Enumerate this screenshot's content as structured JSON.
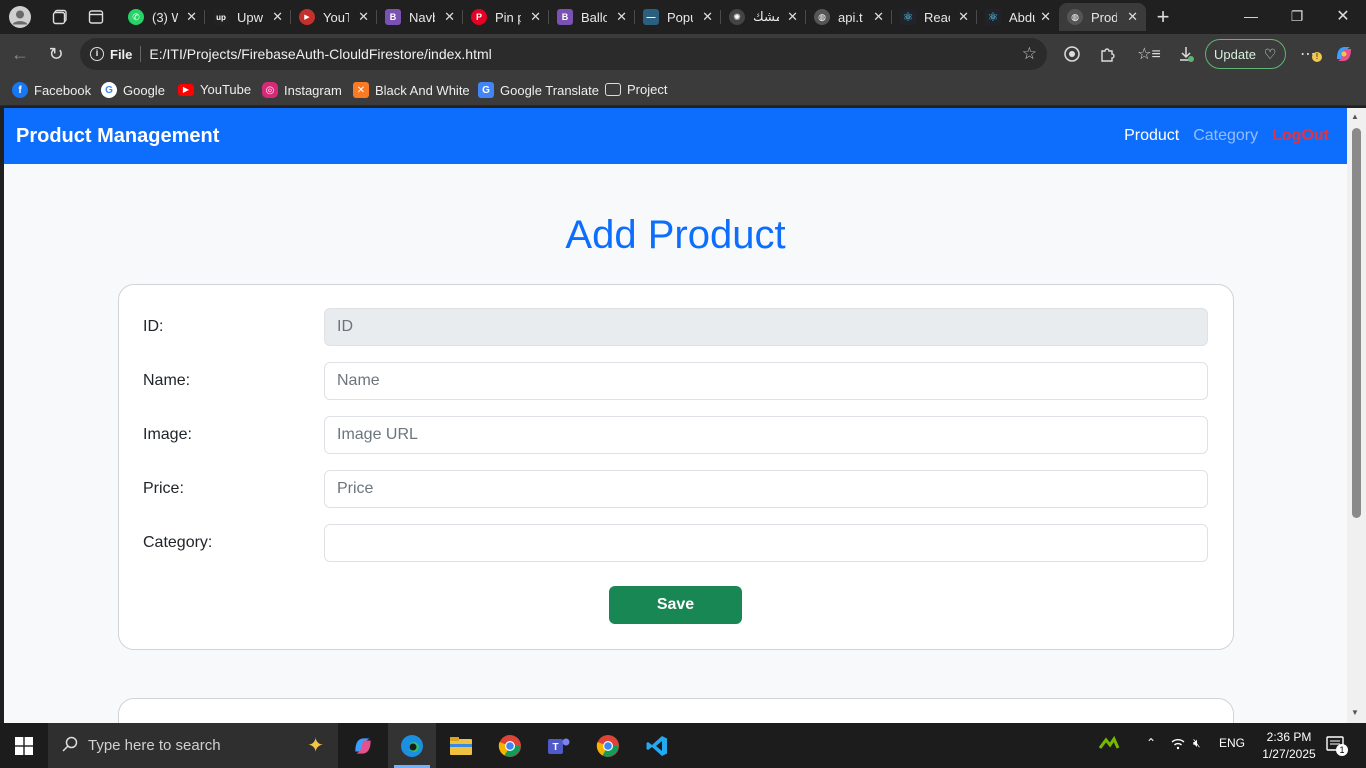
{
  "browser": {
    "tabs": [
      {
        "title": "(3) W",
        "icon": "whatsapp-icon",
        "color": "#25d366",
        "glyph": "✆"
      },
      {
        "title": "Upw",
        "icon": "upwork-icon",
        "color": "#222222",
        "glyph": "up"
      },
      {
        "title": "YouT",
        "icon": "youtube-icon",
        "color": "#c4302b",
        "glyph": "▶"
      },
      {
        "title": "Navb",
        "icon": "bootstrap-icon",
        "color": "#7952b3",
        "glyph": "B"
      },
      {
        "title": "Pin p",
        "icon": "pinterest-icon",
        "color": "#e60023",
        "glyph": "P"
      },
      {
        "title": "Ballo",
        "icon": "bootstrap-icon",
        "color": "#7952b3",
        "glyph": "B"
      },
      {
        "title": "Popu",
        "icon": "site-icon",
        "color": "#2a5f7f",
        "glyph": "—"
      },
      {
        "title": "مشك",
        "icon": "openai-icon",
        "color": "#444444",
        "glyph": "✺"
      },
      {
        "title": "api.t",
        "icon": "globe-icon",
        "color": "#555555",
        "glyph": "◍"
      },
      {
        "title": "Reac",
        "icon": "react-icon",
        "color": "#20232a",
        "glyph": "⚛"
      },
      {
        "title": "Abdu",
        "icon": "react-icon",
        "color": "#20232a",
        "glyph": "⚛"
      },
      {
        "title": "Prod",
        "icon": "globe-icon",
        "color": "#555555",
        "glyph": "◍"
      }
    ],
    "new_tab": "+",
    "address": {
      "scheme_label": "File",
      "url": "E:/ITI/Projects/FirebaseAuth-ClouldFirestore/index.html"
    },
    "update_label": "Update",
    "bookmarks": [
      {
        "label": "Facebook",
        "icon": "facebook-icon",
        "color": "#1877f2",
        "glyph": "f"
      },
      {
        "label": "Google",
        "icon": "google-icon",
        "color": "#ffffff",
        "glyph": "G"
      },
      {
        "label": "YouTube",
        "icon": "youtube-icon",
        "color": "#ff0000",
        "glyph": "▶"
      },
      {
        "label": "Instagram",
        "icon": "instagram-icon",
        "color": "#d62976",
        "glyph": "◎"
      },
      {
        "label": "Black And White",
        "icon": "xampp-icon",
        "color": "#fb7a24",
        "glyph": "✕"
      },
      {
        "label": "Google Translate",
        "icon": "translate-icon",
        "color": "#4285f4",
        "glyph": "G"
      },
      {
        "label": "Project",
        "icon": "folder-icon",
        "color": "#3b3b3b",
        "glyph": "▭"
      }
    ]
  },
  "app": {
    "brand": "Product Management",
    "nav": {
      "product": "Product",
      "category": "Category",
      "logout": "LogOut"
    },
    "heading": "Add Product",
    "form": {
      "id_label": "ID:",
      "id_placeholder": "ID",
      "name_label": "Name:",
      "name_placeholder": "Name",
      "image_label": "Image:",
      "image_placeholder": "Image URL",
      "price_label": "Price:",
      "price_placeholder": "Price",
      "category_label": "Category:",
      "category_value": "",
      "save_label": "Save"
    },
    "colors": {
      "primary": "#0d6efd",
      "success": "#198754",
      "danger": "#dc3545"
    }
  },
  "taskbar": {
    "search_placeholder": "Type here to search",
    "language": "ENG",
    "time": "2:36 PM",
    "date": "1/27/2025",
    "notifications": "1"
  }
}
